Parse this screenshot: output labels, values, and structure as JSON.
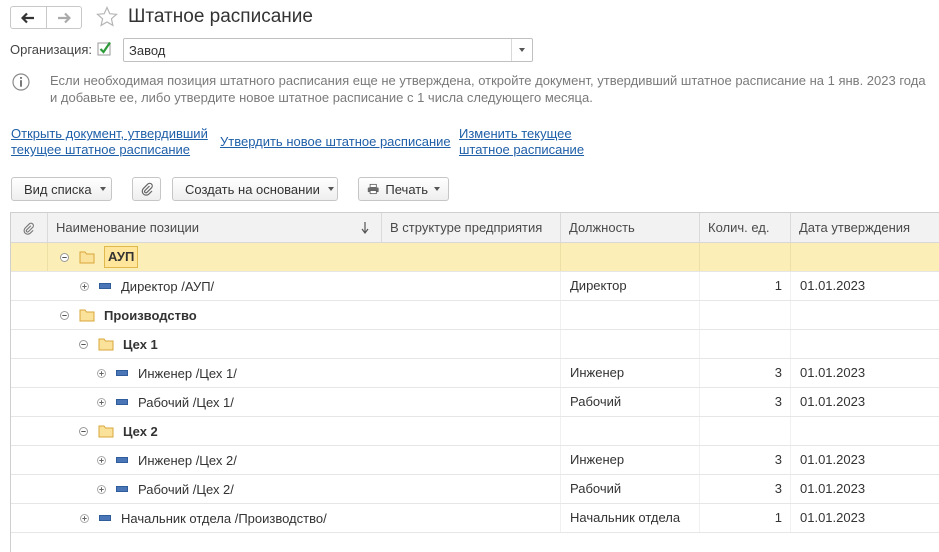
{
  "header": {
    "back_icon": "arrow-left-icon",
    "forward_icon": "arrow-right-icon",
    "favorite_icon": "star-icon",
    "title": "Штатное расписание"
  },
  "org": {
    "label": "Организация:",
    "value": "Завод",
    "checked": true
  },
  "info": {
    "icon": "info-icon",
    "text": "Если необходимая позиция штатного расписания еще не утверждена, откройте документ, утвердивший штатное расписание на 1 янв. 2023 года и добавьте ее, либо утвердите новое штатное расписание с 1 числа следующего месяца."
  },
  "links": {
    "open_doc_line1": "Открыть документ, утвердивший",
    "open_doc_line2": "текущее штатное расписание",
    "approve_new": "Утвердить новое штатное расписание",
    "edit_current_line1": "Изменить текущее",
    "edit_current_line2": "штатное расписание"
  },
  "toolbar": {
    "view_list": "Вид списка",
    "attach_icon": "paperclip-icon",
    "create_based": "Создать на основании",
    "print": "Печать",
    "print_icon": "printer-icon"
  },
  "table": {
    "columns": {
      "clip_icon": "paperclip-icon",
      "name": "Наименование позиции",
      "sort_icon": "arrow-down-icon",
      "structure": "В структуре предприятия",
      "position": "Должность",
      "qty": "Колич. ед.",
      "date": "Дата утверждения"
    },
    "rows": [
      {
        "name": "АУП",
        "structure": "",
        "position": "",
        "qty": "",
        "date": ""
      },
      {
        "name": "Директор /АУП/",
        "structure": "",
        "position": "Директор",
        "qty": "1",
        "date": "01.01.2023"
      },
      {
        "name": "Производство",
        "structure": "",
        "position": "",
        "qty": "",
        "date": ""
      },
      {
        "name": "Цех 1",
        "structure": "",
        "position": "",
        "qty": "",
        "date": ""
      },
      {
        "name": "Инженер /Цех 1/",
        "structure": "",
        "position": "Инженер",
        "qty": "3",
        "date": "01.01.2023"
      },
      {
        "name": "Рабочий /Цех 1/",
        "structure": "",
        "position": "Рабочий",
        "qty": "3",
        "date": "01.01.2023"
      },
      {
        "name": "Цех 2",
        "structure": "",
        "position": "",
        "qty": "",
        "date": ""
      },
      {
        "name": "Инженер /Цех 2/",
        "structure": "",
        "position": "Инженер",
        "qty": "3",
        "date": "01.01.2023"
      },
      {
        "name": "Рабочий /Цех 2/",
        "structure": "",
        "position": "Рабочий",
        "qty": "3",
        "date": "01.01.2023"
      },
      {
        "name": "Начальник отдела /Производство/",
        "structure": "",
        "position": "Начальник отдела",
        "qty": "1",
        "date": "01.01.2023"
      }
    ]
  },
  "colors": {
    "selected_row": "#fbeeb7",
    "link": "#1f5fa8",
    "check_green": "#2e9b3b",
    "folder": "#f3c24f"
  }
}
